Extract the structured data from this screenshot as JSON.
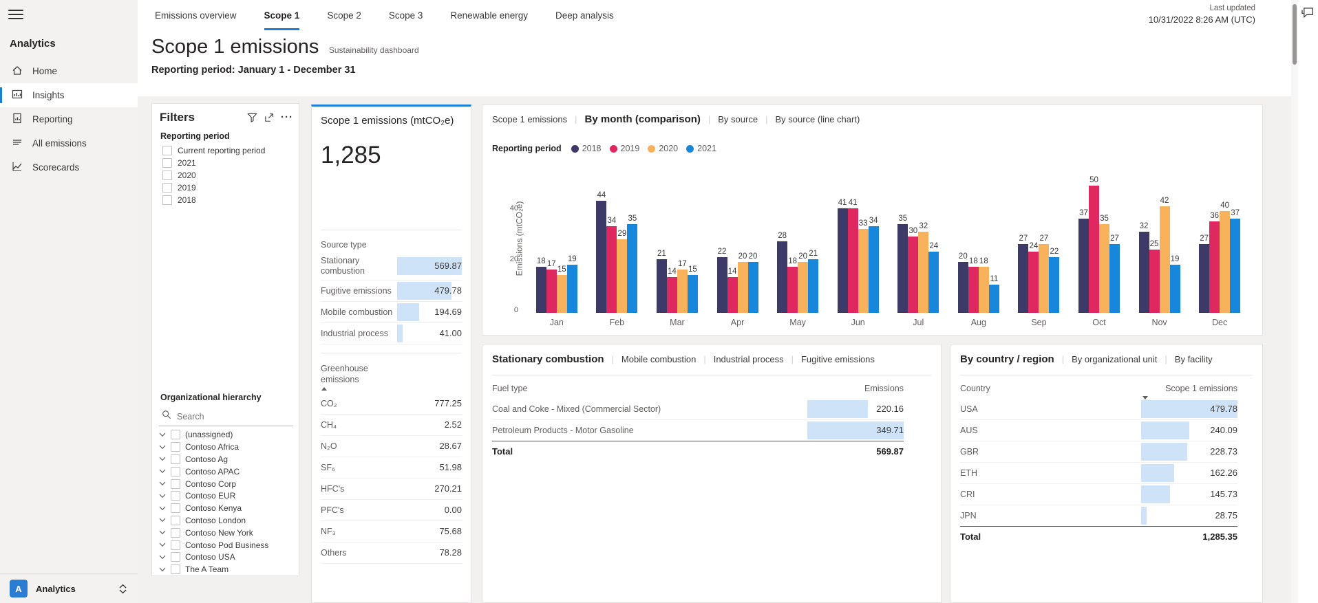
{
  "colors": {
    "accent": "#1a7fd4",
    "databar": "#cfe3f8",
    "sidebar_bg": "#f3f2f1",
    "content_bg": "#f2f1ef"
  },
  "top_nav": {
    "tabs": [
      "Emissions overview",
      "Scope 1",
      "Scope 2",
      "Scope 3",
      "Renewable energy",
      "Deep analysis"
    ],
    "active_tab": "Scope 1",
    "last_updated_label": "Last updated",
    "last_updated_value": "10/31/2022 8:26 AM (UTC)",
    "feedback_icon": "chat-bubble-icon"
  },
  "sidebar": {
    "section": "Analytics",
    "items": [
      {
        "label": "Home",
        "icon": "home-icon"
      },
      {
        "label": "Insights",
        "icon": "insights-chart-icon"
      },
      {
        "label": "Reporting",
        "icon": "report-document-icon"
      },
      {
        "label": "All emissions",
        "icon": "list-lines-icon"
      },
      {
        "label": "Scorecards",
        "icon": "scorecard-line-chart-icon"
      }
    ],
    "active_item": "Insights",
    "workspace": {
      "initial": "A",
      "label": "Analytics",
      "switcher_icon": "up-down-chevrons-icon"
    }
  },
  "page": {
    "title": "Scope 1 emissions",
    "subtitle": "Sustainability dashboard",
    "period": "Reporting period: January 1 - December 31"
  },
  "filters": {
    "title": "Filters",
    "icons": [
      "filter-funnel-icon",
      "expand-icon",
      "more-options-icon"
    ],
    "reporting_period": {
      "label": "Reporting period",
      "options": [
        "Current reporting period",
        "2021",
        "2020",
        "2019",
        "2018"
      ]
    },
    "org_hierarchy": {
      "label": "Organizational hierarchy",
      "search_placeholder": "Search",
      "items": [
        "(unassigned)",
        "Contoso Africa",
        "Contoso Ag",
        "Contoso APAC",
        "Contoso Corp",
        "Contoso EUR",
        "Contoso Kenya",
        "Contoso London",
        "Contoso New York",
        "Contoso Pod Business",
        "Contoso USA",
        "The A Team"
      ]
    }
  },
  "kpi": {
    "title": "Scope 1 emissions (mtCO₂e)",
    "value": "1,285",
    "source_type": {
      "label": "Source type",
      "rows": [
        {
          "label": "Stationary combustion",
          "value": "569.87",
          "bar_pct": 100
        },
        {
          "label": "Fugitive emissions",
          "value": "479.78",
          "bar_pct": 84
        },
        {
          "label": "Mobile combustion",
          "value": "194.69",
          "bar_pct": 34
        },
        {
          "label": "Industrial process",
          "value": "41.00",
          "bar_pct": 8
        }
      ]
    },
    "greenhouse": {
      "label": "Greenhouse emissions",
      "sort": "asc",
      "rows": [
        {
          "label": "CO₂",
          "value": "777.25"
        },
        {
          "label": "CH₄",
          "value": "2.52"
        },
        {
          "label": "N₂O",
          "value": "28.67"
        },
        {
          "label": "SF₆",
          "value": "51.98"
        },
        {
          "label": "HFC's",
          "value": "270.21"
        },
        {
          "label": "PFC's",
          "value": "0.00"
        },
        {
          "label": "NF₃",
          "value": "75.68"
        },
        {
          "label": "Others",
          "value": "78.28"
        }
      ]
    }
  },
  "chart_card": {
    "tabs": [
      "Scope 1 emissions",
      "By month (comparison)",
      "By source",
      "By source (line chart)"
    ],
    "active_tab": "By month (comparison)",
    "legend_label": "Reporting period"
  },
  "chart_data": {
    "type": "bar",
    "title": "Scope 1 emissions by month (comparison)",
    "xlabel": "",
    "ylabel": "Emissions (mtCO₂e)",
    "yticks": [
      0,
      20,
      40
    ],
    "ylim": [
      0,
      50
    ],
    "grid": false,
    "legend_position": "top",
    "categories": [
      "Jan",
      "Feb",
      "Mar",
      "Apr",
      "May",
      "Jun",
      "Jul",
      "Aug",
      "Sep",
      "Oct",
      "Nov",
      "Dec"
    ],
    "series": [
      {
        "name": "2018",
        "color": "#3D3A68",
        "values": [
          18,
          44,
          21,
          22,
          28,
          41,
          35,
          20,
          27,
          37,
          32,
          27
        ]
      },
      {
        "name": "2019",
        "color": "#DE285F",
        "values": [
          17,
          34,
          14,
          14,
          18,
          41,
          30,
          18,
          24,
          50,
          25,
          36
        ]
      },
      {
        "name": "2020",
        "color": "#F8B25C",
        "values": [
          15,
          29,
          17,
          20,
          20,
          33,
          32,
          18,
          27,
          35,
          42,
          40
        ]
      },
      {
        "name": "2021",
        "color": "#1787DB",
        "values": [
          19,
          35,
          15,
          20,
          21,
          34,
          24,
          11,
          22,
          27,
          19,
          37
        ]
      }
    ]
  },
  "fuel_card": {
    "tabs": [
      "Stationary combustion",
      "Mobile combustion",
      "Industrial process",
      "Fugitive emissions"
    ],
    "active_tab": "Stationary combustion",
    "columns": {
      "left": "Fuel type",
      "right": "Emissions"
    },
    "rows": [
      {
        "label": "Coal and Coke - Mixed (Commercial Sector)",
        "value": "220.16",
        "bar_pct": 63
      },
      {
        "label": "Petroleum Products - Motor Gasoline",
        "value": "349.71",
        "bar_pct": 100
      }
    ],
    "total_label": "Total",
    "total_value": "569.87"
  },
  "country_card": {
    "tabs": [
      "By country / region",
      "By organizational unit",
      "By facility"
    ],
    "active_tab": "By country / region",
    "columns": {
      "left": "Country",
      "right": "Scope 1 emissions"
    },
    "sort": "desc",
    "rows": [
      {
        "label": "USA",
        "value": "479.78",
        "bar_pct": 100
      },
      {
        "label": "AUS",
        "value": "240.09",
        "bar_pct": 50
      },
      {
        "label": "GBR",
        "value": "228.73",
        "bar_pct": 48
      },
      {
        "label": "ETH",
        "value": "162.26",
        "bar_pct": 34
      },
      {
        "label": "CRI",
        "value": "145.73",
        "bar_pct": 30
      },
      {
        "label": "JPN",
        "value": "28.75",
        "bar_pct": 6
      }
    ],
    "total_label": "Total",
    "total_value": "1,285.35"
  }
}
